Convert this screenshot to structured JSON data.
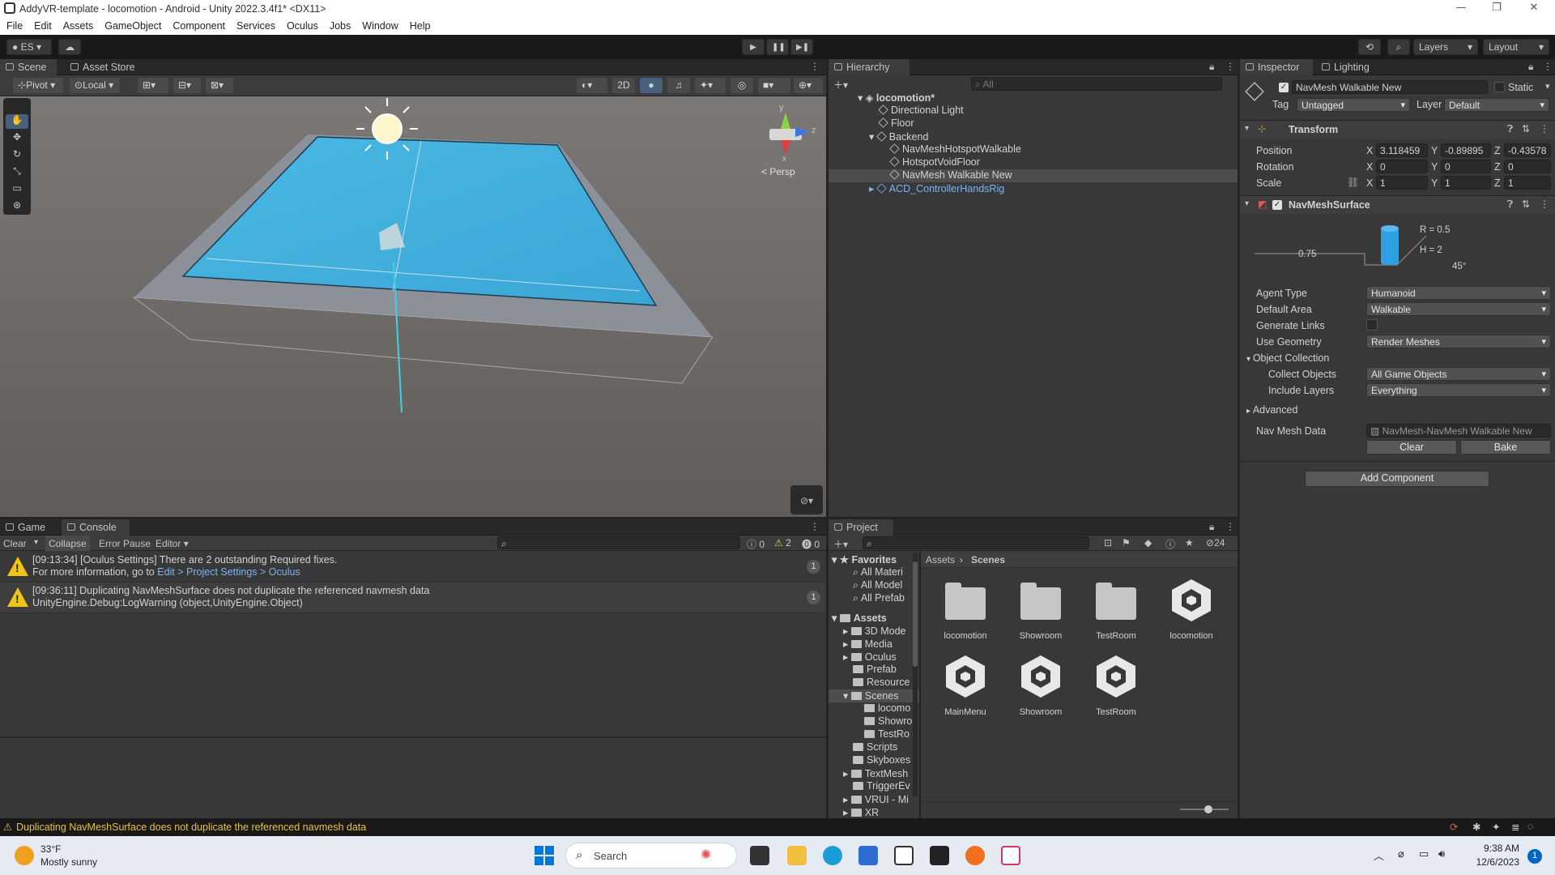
{
  "window": {
    "title": "AddyVR-template - locomotion - Android - Unity 2022.3.4f1* <DX11>",
    "min": "—",
    "max": "❐",
    "close": "✕"
  },
  "menu": [
    "File",
    "Edit",
    "Assets",
    "GameObject",
    "Component",
    "Services",
    "Oculus",
    "Jobs",
    "Window",
    "Help"
  ],
  "toolbar": {
    "account": "ES",
    "layers": "Layers",
    "layout": "Layout"
  },
  "scene_panel": {
    "tab_scene": "Scene",
    "tab_store": "Asset Store",
    "pivot": "Pivot",
    "local": "Local",
    "btn_2d": "2D",
    "persp": "< Persp",
    "axis_y": "y",
    "axis_z": "z",
    "axis_x": "x"
  },
  "hierarchy": {
    "tab": "Hierarchy",
    "search_placeholder": "All",
    "scene": "locomotion*",
    "items": [
      "Directional Light",
      "Floor",
      "Backend",
      "NavMeshHotspotWalkable",
      "HotspotVoidFloor",
      "NavMesh Walkable New",
      "ACD_ControllerHandsRig"
    ]
  },
  "inspector": {
    "tab": "Inspector",
    "tab2": "Lighting",
    "object_name": "NavMesh Walkable New",
    "static": "Static",
    "tag_label": "Tag",
    "tag": "Untagged",
    "layer_label": "Layer",
    "layer": "Default",
    "transform": {
      "title": "Transform",
      "position": "Position",
      "rotation": "Rotation",
      "scale": "Scale",
      "x": "X",
      "y": "Y",
      "z": "Z",
      "pos": [
        "3.118459",
        "-0.89895",
        "-0.43578"
      ],
      "rot": [
        "0",
        "0",
        "0"
      ],
      "scl": [
        "1",
        "1",
        "1"
      ]
    },
    "navmesh": {
      "title": "NavMeshSurface",
      "r": "R = 0.5",
      "h": "H = 2",
      "step": "0.75",
      "slope": "45°",
      "agent_type_label": "Agent Type",
      "agent_type": "Humanoid",
      "default_area_label": "Default Area",
      "default_area": "Walkable",
      "gen_links_label": "Generate Links",
      "use_geom_label": "Use Geometry",
      "use_geom": "Render Meshes",
      "obj_coll": "Object Collection",
      "collect_label": "Collect Objects",
      "collect": "All Game Objects",
      "include_label": "Include Layers",
      "include": "Everything",
      "advanced": "Advanced",
      "data_label": "Nav Mesh Data",
      "data": "NavMesh-NavMesh Walkable New",
      "clear": "Clear",
      "bake": "Bake"
    },
    "add_component": "Add Component"
  },
  "console": {
    "tab_game": "Game",
    "tab_console": "Console",
    "clear": "Clear",
    "collapse": "Collapse",
    "error_pause": "Error Pause",
    "editor": "Editor",
    "count_info": "0",
    "count_warn": "2",
    "count_err": "0",
    "rows": [
      {
        "line1": "[09:13:34] [Oculus Settings] There are 2 outstanding Required fixes.",
        "line2a": "For more information, go to ",
        "line2b": "Edit > Project Settings > Oculus",
        "count": "1"
      },
      {
        "line1": "[09:36:11] Duplicating NavMeshSurface does not duplicate the referenced navmesh data",
        "line2a": "UnityEngine.Debug:LogWarning (object,UnityEngine.Object)",
        "line2b": "",
        "count": "1"
      }
    ]
  },
  "project": {
    "tab": "Project",
    "hidden_count": "24",
    "breadcrumb_root": "Assets",
    "breadcrumb_leaf": "Scenes",
    "favorites": "Favorites",
    "fav_items": [
      "All Materi",
      "All Model",
      "All Prefab"
    ],
    "assets": "Assets",
    "tree": [
      "3D Mode",
      "Media",
      "Oculus",
      "Prefab",
      "Resource",
      "Scenes",
      "locomo",
      "Showro",
      "TestRo",
      "Scripts",
      "Skyboxes",
      "TextMesh",
      "TriggerEv",
      "VRUI - Mi",
      "XR"
    ],
    "grid": [
      {
        "name": "locomotion",
        "kind": "folder"
      },
      {
        "name": "Showroom",
        "kind": "folder"
      },
      {
        "name": "TestRoom",
        "kind": "folder"
      },
      {
        "name": "locomotion",
        "kind": "unity"
      },
      {
        "name": "MainMenu",
        "kind": "unity"
      },
      {
        "name": "Showroom",
        "kind": "unity"
      },
      {
        "name": "TestRoom",
        "kind": "unity"
      }
    ]
  },
  "status": {
    "message": "Duplicating NavMeshSurface does not duplicate the referenced navmesh data"
  },
  "taskbar": {
    "temp": "33°F",
    "weather": "Mostly sunny",
    "search": "Search",
    "time": "9:38 AM",
    "date": "12/6/2023",
    "notif": "1"
  }
}
